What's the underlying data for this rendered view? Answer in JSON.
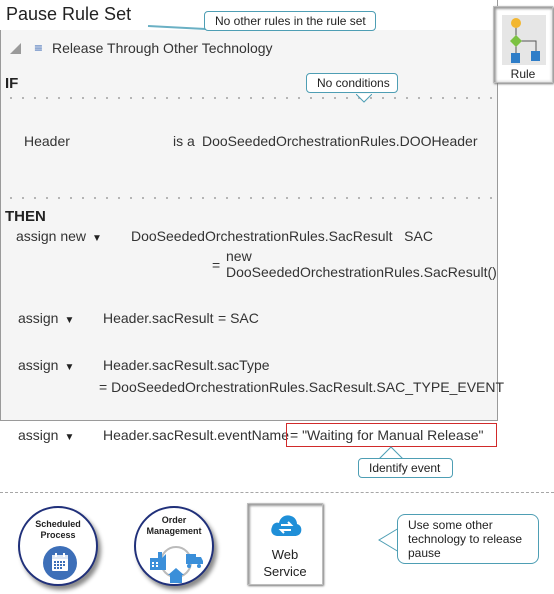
{
  "rule_set": {
    "title": "Pause Rule Set",
    "rule_name": "Release Through Other Technology",
    "if_label": "IF",
    "then_label": "THEN",
    "condition": {
      "variable": "Header",
      "operator": "is a",
      "type": "DooSeededOrchestrationRules.DOOHeader"
    },
    "actions": [
      {
        "verb": "assign new",
        "target": "DooSeededOrchestrationRules.SacResult   SAC",
        "eq": "=",
        "value_line1": "new",
        "value_line2": "DooSeededOrchestrationRules.SacResult()"
      },
      {
        "verb": "assign",
        "target": "Header.sacResult",
        "value": "= SAC"
      },
      {
        "verb": "assign",
        "target": "Header.sacResult.sacType",
        "value": "= DooSeededOrchestrationRules.SacResult.SAC_TYPE_EVENT"
      },
      {
        "verb": "assign",
        "target": "Header.sacResult.eventName",
        "value": "= \"Waiting for Manual Release\""
      }
    ]
  },
  "callouts": {
    "no_other_rules": "No other rules in the rule set",
    "no_conditions": "No conditions",
    "identify_event": "Identify event",
    "other_technology": [
      "Use some other",
      "technology to release",
      "pause"
    ]
  },
  "rule_button": {
    "label": "Rule",
    "icon": "rule-flow-icon"
  },
  "integrations": [
    {
      "label_line1": "Scheduled",
      "label_line2": "Process",
      "icon": "calendar-icon"
    },
    {
      "label_line1": "Order",
      "label_line2": "Management",
      "icon": "factory-truck-home-icon"
    },
    {
      "label_line1": "Web",
      "label_line2": "Service",
      "icon": "cloud-sync-icon"
    }
  ],
  "colors": {
    "callout_border": "#4e9eb4",
    "highlight_border": "#d12a2a",
    "circle_border": "#20307a",
    "icon_blue": "#3b8fd9"
  }
}
